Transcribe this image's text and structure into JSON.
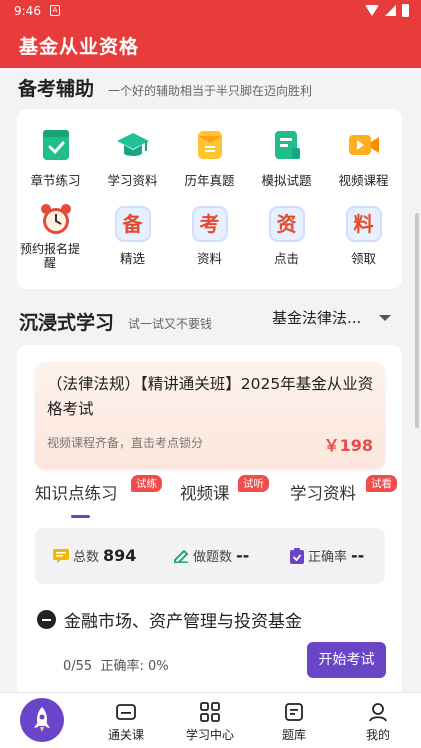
{
  "status_bar": {
    "time": "9:46",
    "notification_icon": "A"
  },
  "app_bar": {
    "title": "基金从业资格"
  },
  "prep": {
    "title": "备考辅助",
    "subtitle": "一个好的辅助相当于半只脚在迈向胜利",
    "items": [
      {
        "label": "章节练习",
        "icon": "chapter-practice-icon"
      },
      {
        "label": "学习资料",
        "icon": "graduation-cap-icon"
      },
      {
        "label": "历年真题",
        "icon": "past-exam-icon"
      },
      {
        "label": "模拟试题",
        "icon": "mock-exam-icon"
      },
      {
        "label": "视频课程",
        "icon": "video-course-icon"
      },
      {
        "label": "预约报名提醒",
        "icon": "alarm-clock-icon"
      },
      {
        "label": "精选",
        "char": "备"
      },
      {
        "label": "资料",
        "char": "考"
      },
      {
        "label": "点击",
        "char": "资"
      },
      {
        "label": "领取",
        "char": "料"
      }
    ]
  },
  "immersive": {
    "title": "沉浸式学习",
    "subtitle": "试一试又不要钱",
    "subject": "基金法律法..."
  },
  "course": {
    "title": "（法律法规）【精讲通关班】2025年基金从业资格考试",
    "desc": "视频课程齐备，直击考点锁分",
    "price": "￥198"
  },
  "tabs": [
    {
      "label": "知识点练习",
      "tag": "试练"
    },
    {
      "label": "视频课",
      "tag": "试听"
    },
    {
      "label": "学习资料",
      "tag": "试看"
    }
  ],
  "stats": {
    "total_label": "总数",
    "total_value": "894",
    "done_label": "做题数",
    "done_value": "--",
    "rate_label": "正确率",
    "rate_value": "--"
  },
  "chapter": {
    "title": "金融市场、资产管理与投资基金",
    "progress": "0/55",
    "accuracy": "正确率: 0%",
    "start_label": "开始考试"
  },
  "bottom_nav": [
    {
      "label": "通关课"
    },
    {
      "label": "学习中心"
    },
    {
      "label": "题库"
    },
    {
      "label": "我的"
    }
  ],
  "colors": {
    "primary_red": "#e83c3c",
    "accent_purple": "#6a45c8",
    "price_red": "#e94b4b"
  }
}
